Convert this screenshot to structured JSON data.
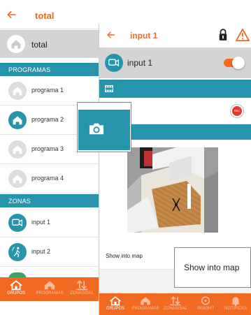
{
  "back_screen": {
    "title": "total",
    "selected_group": "total",
    "sections": {
      "programas": "PROGRAMAS",
      "zonas": "ZONAS"
    },
    "programas": [
      {
        "label": "programa 1",
        "active": false
      },
      {
        "label": "programa 2",
        "active": true
      },
      {
        "label": "programa 3",
        "active": false
      },
      {
        "label": "programa 4",
        "active": false
      }
    ],
    "zonas": [
      {
        "label": "input 1",
        "icon": "camera-icon"
      },
      {
        "label": "input 2",
        "icon": "motion-sensor-icon"
      }
    ],
    "nav": [
      {
        "label": "GRUPOS",
        "icon": "home-icon"
      },
      {
        "label": "PROGRAMAS",
        "icon": "home-icon"
      },
      {
        "label": "ZONAS/SAL",
        "icon": "inout-icon"
      }
    ]
  },
  "front_screen": {
    "title": "input 1",
    "device_name": "input 1",
    "toggle_on": true,
    "rec_label": "REC",
    "show_into_map_label": "Show into map",
    "nav": [
      {
        "label": "GRUPOS",
        "icon": "home-icon"
      },
      {
        "label": "PROGRAMAS",
        "icon": "home-icon"
      },
      {
        "label": "ZONAS/SAL",
        "icon": "inout-icon"
      },
      {
        "label": "INSIGHT",
        "icon": "target-icon"
      },
      {
        "label": "NOTIFICAS",
        "icon": "bell-icon"
      }
    ]
  },
  "tooltip": {
    "text": "Show into map"
  },
  "colors": {
    "accent_orange": "#f26a21",
    "teal": "#2694aa",
    "gray_bar": "#d4d4d4",
    "rec_red": "#e23b2e"
  }
}
